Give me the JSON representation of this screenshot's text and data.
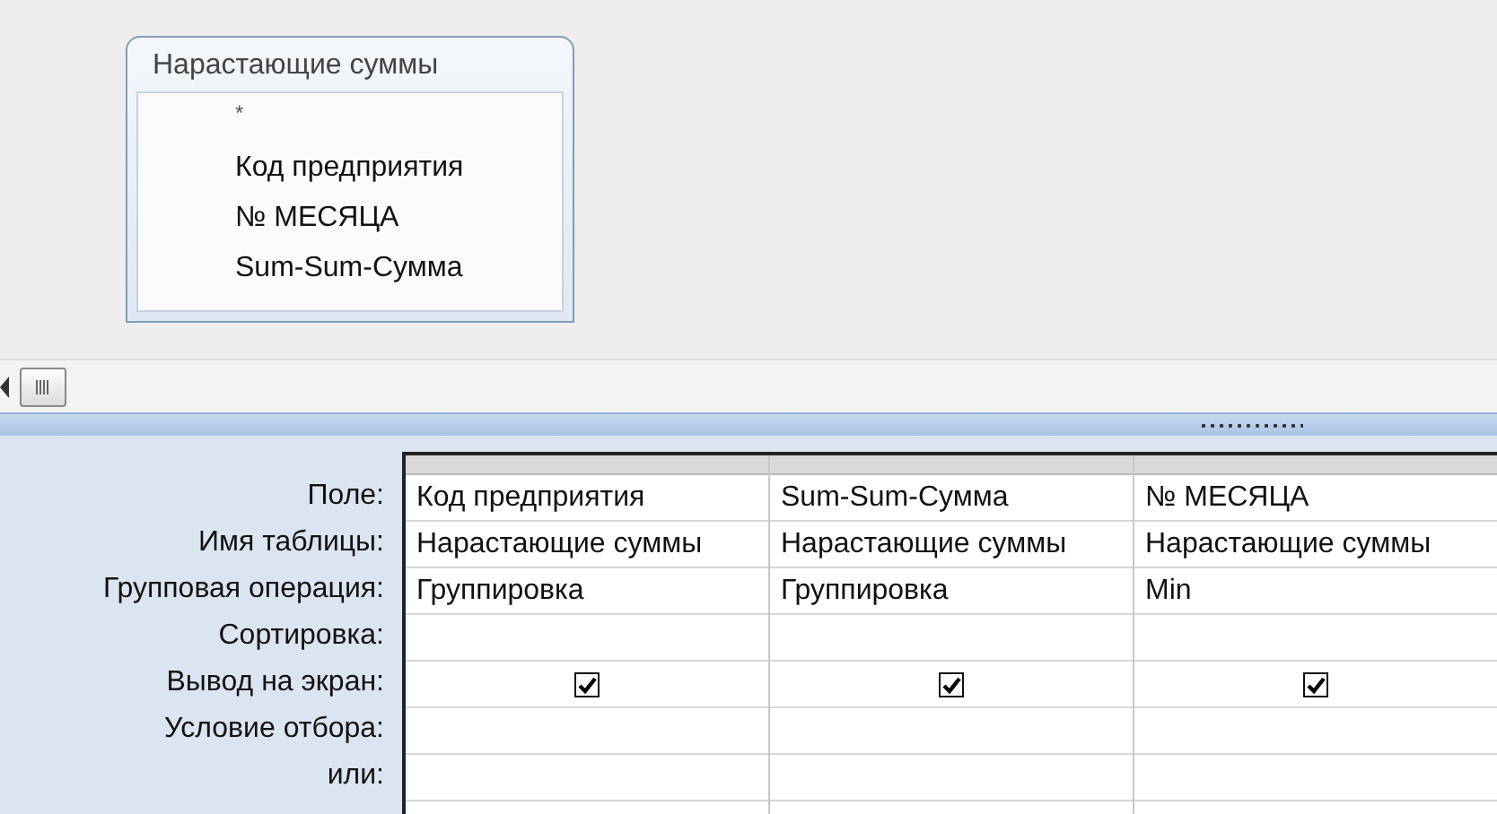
{
  "query_table": {
    "title": "Нарастающие суммы",
    "fields": [
      "*",
      "Код предприятия",
      "№ МЕСЯЦА",
      "Sum-Sum-Сумма"
    ]
  },
  "grid": {
    "rows": [
      {
        "label": "Поле:",
        "kind": "field"
      },
      {
        "label": "Имя таблицы:",
        "kind": "table"
      },
      {
        "label": "Групповая операция:",
        "kind": "total"
      },
      {
        "label": "Сортировка:",
        "kind": "sort"
      },
      {
        "label": "Вывод на экран:",
        "kind": "show"
      },
      {
        "label": "Условие отбора:",
        "kind": "criteria"
      },
      {
        "label": "или:",
        "kind": "or"
      }
    ],
    "columns": [
      {
        "field": "Код предприятия",
        "table": "Нарастающие суммы",
        "total": "Группировка",
        "show": true
      },
      {
        "field": "Sum-Sum-Сумма",
        "table": "Нарастающие суммы",
        "total": "Группировка",
        "show": true
      },
      {
        "field": "№ МЕСЯЦА",
        "table": "Нарастающие суммы",
        "total": "Min",
        "show": true
      }
    ]
  }
}
